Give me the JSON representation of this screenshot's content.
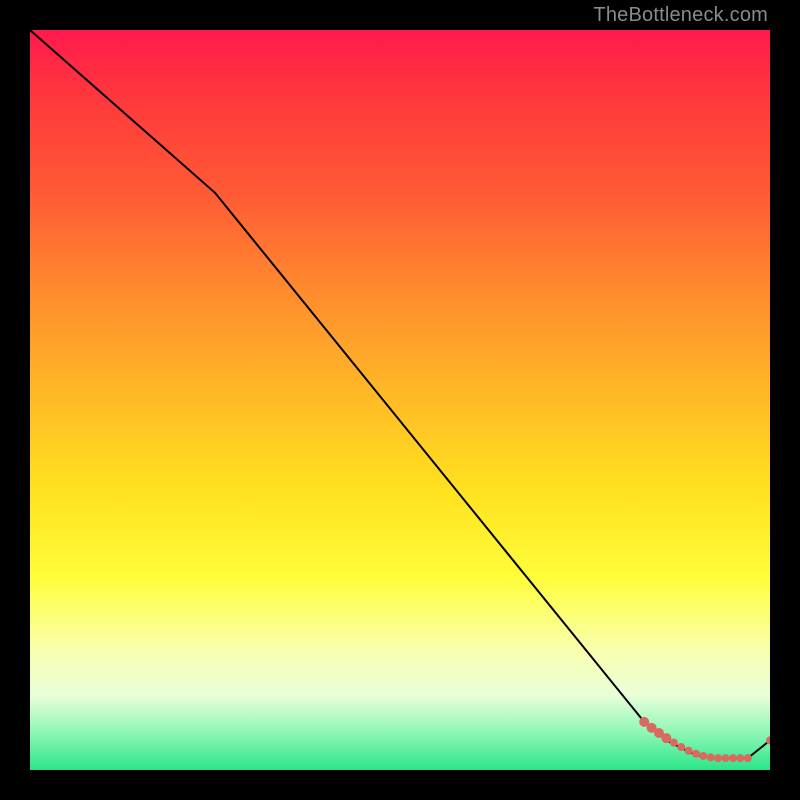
{
  "watermark": "TheBottleneck.com",
  "colors": {
    "line": "#000000",
    "dots": "#d96a60"
  },
  "chart_data": {
    "type": "line",
    "title": "",
    "xlabel": "",
    "ylabel": "",
    "xlim": [
      0,
      100
    ],
    "ylim": [
      0,
      100
    ],
    "grid": false,
    "legend": false,
    "series": [
      {
        "name": "bottleneck-curve",
        "x": [
          0,
          25,
          83,
          85,
          86,
          88,
          89,
          90,
          91.5,
          93,
          94,
          95.5,
          97,
          100
        ],
        "y": [
          100,
          78,
          6.5,
          5,
          4,
          3,
          2.5,
          2,
          1.8,
          1.6,
          1.6,
          1.6,
          1.6,
          4
        ]
      }
    ],
    "highlight": {
      "name": "highlight-dots",
      "x": [
        83,
        84,
        85,
        86,
        87,
        88,
        89,
        90,
        91,
        92,
        93,
        94,
        95,
        96,
        97,
        100
      ],
      "y": [
        6.5,
        5.7,
        5,
        4.3,
        3.7,
        3.1,
        2.6,
        2.2,
        1.9,
        1.7,
        1.6,
        1.6,
        1.6,
        1.6,
        1.6,
        4
      ]
    }
  }
}
